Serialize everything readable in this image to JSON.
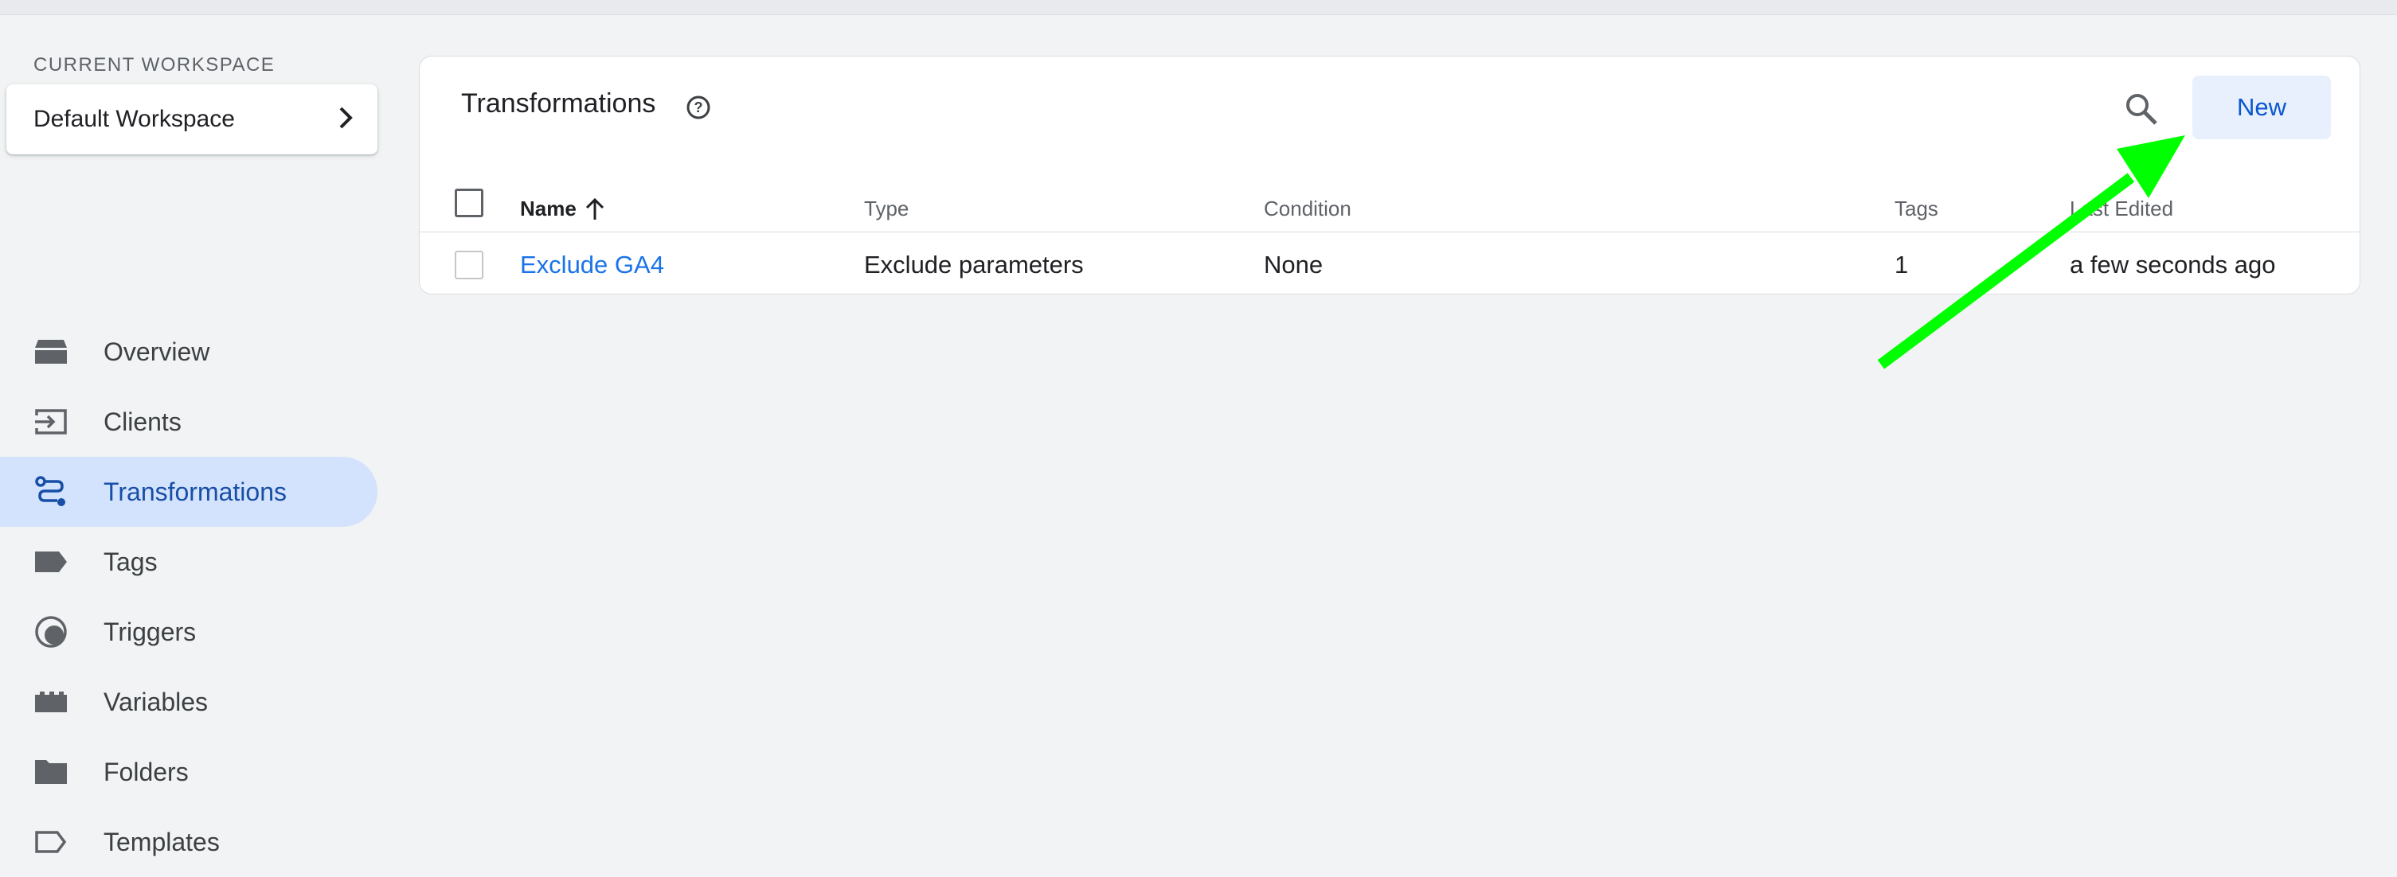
{
  "sidebar": {
    "workspace_label": "CURRENT WORKSPACE",
    "workspace_name": "Default Workspace",
    "items": [
      {
        "label": "Overview",
        "icon": "overview-icon"
      },
      {
        "label": "Clients",
        "icon": "clients-icon"
      },
      {
        "label": "Transformations",
        "icon": "transformations-icon",
        "active": true
      },
      {
        "label": "Tags",
        "icon": "tag-icon"
      },
      {
        "label": "Triggers",
        "icon": "triggers-icon"
      },
      {
        "label": "Variables",
        "icon": "variables-icon"
      },
      {
        "label": "Folders",
        "icon": "folder-icon"
      },
      {
        "label": "Templates",
        "icon": "templates-icon"
      }
    ]
  },
  "main": {
    "title": "Transformations",
    "new_label": "New",
    "columns": [
      "Name",
      "Type",
      "Condition",
      "Tags",
      "Last Edited"
    ],
    "rows": [
      {
        "name": "Exclude GA4",
        "type": "Exclude parameters",
        "condition": "None",
        "tags": "1",
        "last_edited": "a few seconds ago"
      }
    ]
  },
  "colors": {
    "accent": "#0b57d0",
    "link": "#1a73e8",
    "active_nav_bg": "#d3e3fd",
    "annotation_arrow": "#00ff00"
  }
}
